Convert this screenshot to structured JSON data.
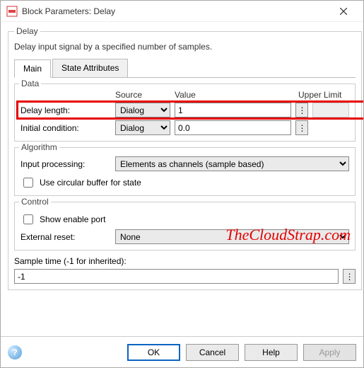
{
  "window": {
    "title": "Block Parameters: Delay"
  },
  "outer": {
    "legend": "Delay",
    "description": "Delay input signal by a specified number of samples."
  },
  "tabs": {
    "main": "Main",
    "state_attributes": "State Attributes"
  },
  "data_group": {
    "legend": "Data",
    "headers": {
      "source": "Source",
      "value": "Value",
      "upper_limit": "Upper Limit"
    },
    "delay_length": {
      "label": "Delay length:",
      "source": "Dialog",
      "value": "1"
    },
    "initial_condition": {
      "label": "Initial condition:",
      "source": "Dialog",
      "value": "0.0"
    }
  },
  "algorithm": {
    "legend": "Algorithm",
    "input_processing": {
      "label": "Input processing:",
      "value": "Elements as channels (sample based)"
    },
    "circular_buffer": {
      "label": "Use circular buffer for state",
      "checked": false
    }
  },
  "control": {
    "legend": "Control",
    "show_enable_port": {
      "label": "Show enable port",
      "checked": false
    },
    "external_reset": {
      "label": "External reset:",
      "value": "None"
    }
  },
  "sample_time": {
    "label": "Sample time (-1 for inherited):",
    "value": "-1"
  },
  "buttons": {
    "ok": "OK",
    "cancel": "Cancel",
    "help": "Help",
    "apply": "Apply"
  },
  "watermark": "TheCloudStrap.com",
  "icons": {
    "more": "⋮"
  }
}
